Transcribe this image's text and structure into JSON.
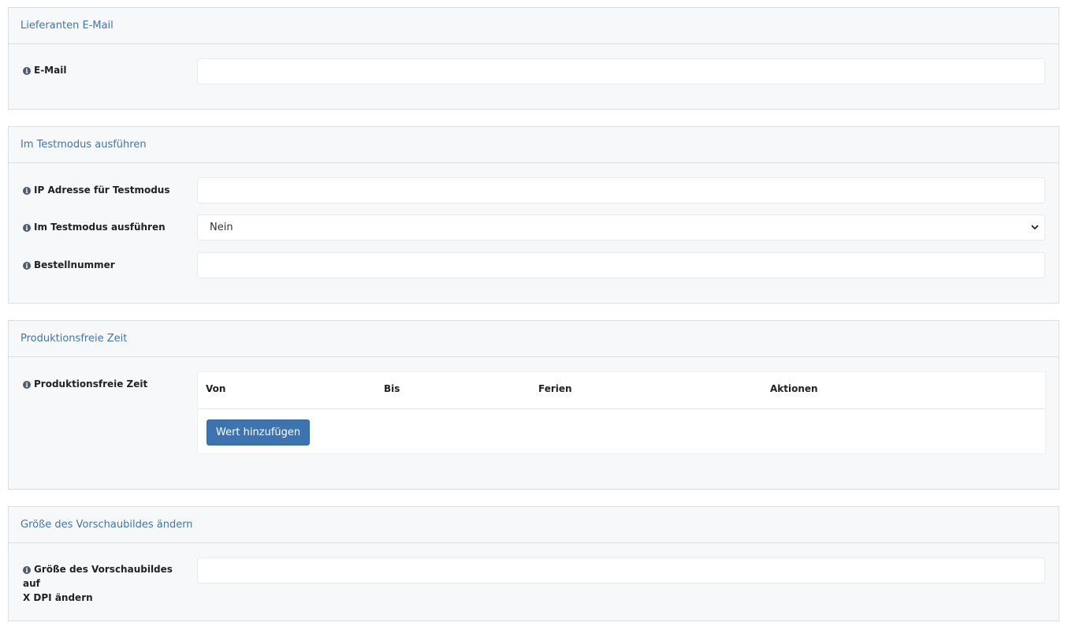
{
  "sections": [
    {
      "title": "Lieferanten E-Mail",
      "fields": [
        {
          "label": "E-Mail",
          "value": ""
        }
      ]
    },
    {
      "title": "Im Testmodus ausführen",
      "fields": [
        {
          "label": "IP Adresse für Testmodus",
          "value": ""
        },
        {
          "label": "Im Testmodus ausführen",
          "value": "Nein"
        },
        {
          "label": "Bestellnummer",
          "value": ""
        }
      ]
    },
    {
      "title": "Produktionsfreie Zeit",
      "fields": [
        {
          "label": "Produktionsfreie Zeit"
        }
      ],
      "table": {
        "columns": [
          "Von",
          "Bis",
          "Ferien",
          "Aktionen"
        ],
        "add_button": "Wert hinzufügen"
      }
    },
    {
      "title": "Größe des Vorschaubildes ändern",
      "fields": [
        {
          "label_line1": "Größe des Vorschaubildes auf",
          "label_line2": "X DPI ändern",
          "value": ""
        }
      ]
    }
  ],
  "icons": {
    "info": "info-circle-icon",
    "select_arrow": "chevron-down-icon"
  },
  "colors": {
    "accent": "#3d74af",
    "section_title": "#3f76ad",
    "panel_bg": "#f7f8f9"
  }
}
